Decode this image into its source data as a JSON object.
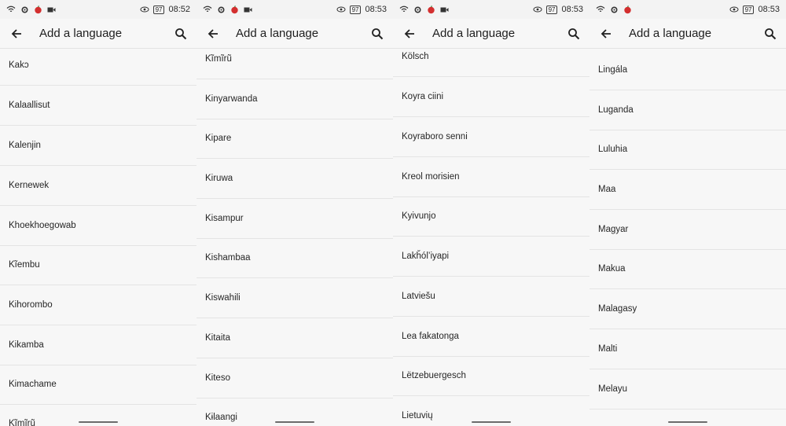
{
  "colors": {
    "background": "#f7f7f7",
    "divider": "#e4e4e4",
    "text": "#262626"
  },
  "screens": [
    {
      "status": {
        "time": "08:52",
        "battery": "97"
      },
      "title": "Add a language",
      "items": [
        "Kakɔ",
        "Kalaallisut",
        "Kalenjin",
        "Kernewek",
        "Khoekhoegowab",
        "Kĩembu",
        "Kihorombo",
        "Kikamba",
        "Kimachame",
        "Kĩmĩrũ"
      ]
    },
    {
      "status": {
        "time": "08:53",
        "battery": "97"
      },
      "title": "Add a language",
      "items": [
        "Kĩmĩrũ",
        "Kinyarwanda",
        "Kipare",
        "Kiruwa",
        "Kisampur",
        "Kishambaa",
        "Kiswahili",
        "Kitaita",
        "Kiteso",
        "Kɨlaangi"
      ]
    },
    {
      "status": {
        "time": "08:53",
        "battery": "97"
      },
      "title": "Add a language",
      "items": [
        "Kölsch",
        "Koyra ciini",
        "Koyraboro senni",
        "Kreol morisien",
        "Kyivunjo",
        "Lakȟól’iyapi",
        "Latviešu",
        "Lea fakatonga",
        "Lëtzebuergesch",
        "Lietuvių"
      ]
    },
    {
      "status": {
        "time": "08:53",
        "battery": "97"
      },
      "title": "Add a language",
      "items": [
        "Lingála",
        "Luganda",
        "Luluhia",
        "Maa",
        "Magyar",
        "Makua",
        "Malagasy",
        "Malti",
        "Melayu"
      ]
    }
  ]
}
